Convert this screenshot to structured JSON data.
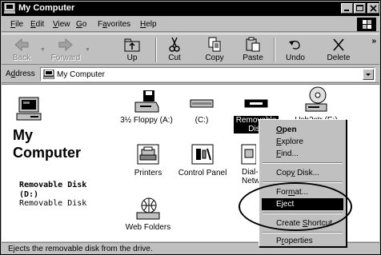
{
  "window": {
    "title": "My Computer"
  },
  "menu": {
    "items": [
      {
        "label_u": "F",
        "label_rest": "ile"
      },
      {
        "label_u": "E",
        "label_rest": "dit"
      },
      {
        "label_u": "V",
        "label_rest": "iew"
      },
      {
        "label_u": "G",
        "label_rest": "o"
      },
      {
        "label_pre": "F",
        "label_u": "a",
        "label_rest": "vorites"
      },
      {
        "label_u": "H",
        "label_rest": "elp"
      }
    ]
  },
  "toolbar": {
    "back": "Back",
    "forward": "Forward",
    "up": "Up",
    "cut": "Cut",
    "copy": "Copy",
    "paste": "Paste",
    "undo": "Undo",
    "delete": "Delete",
    "more": "»"
  },
  "address": {
    "label_pre": "A",
    "label_u": "d",
    "label_rest": "dress",
    "value": "My Computer"
  },
  "main": {
    "title_line1": "My",
    "title_line2": "Computer",
    "selected_name": "Removable Disk (D:)",
    "selected_type": "Removable Disk",
    "items": {
      "floppy": "3½ Floppy (A:)",
      "c_drive": "(C:)",
      "removable_line1": "Removable",
      "removable_line2": "Disk",
      "usb": "Usb2str (E:)",
      "printers": "Printers",
      "control_panel": "Control Panel",
      "dialup_line1": "Dial-",
      "dialup_line2": "Netwo",
      "web_folders": "Web Folders"
    }
  },
  "context_menu": {
    "open_u": "O",
    "open_rest": "pen",
    "explore_u": "E",
    "explore_rest": "xplore",
    "find_u": "F",
    "find_rest": "ind...",
    "copy_disk_pre": "Cop",
    "copy_disk_u": "y",
    "copy_disk_rest": " Disk...",
    "format_pre": "For",
    "format_u": "m",
    "format_rest": "at...",
    "eject_pre": "E",
    "eject_u": "j",
    "eject_rest": "ect",
    "shortcut_pre": "Create ",
    "shortcut_u": "S",
    "shortcut_rest": "hortcut",
    "properties_pre": "P",
    "properties_u": "r",
    "properties_rest": "operties"
  },
  "status": {
    "text": "Ejects the removable disk from the drive."
  }
}
